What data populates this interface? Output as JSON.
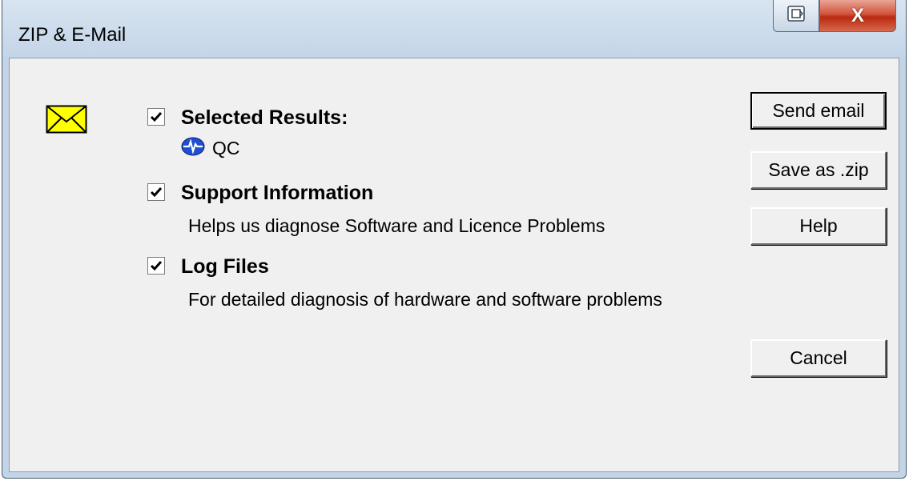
{
  "window": {
    "title": "ZIP & E-Mail",
    "close_glyph": "X"
  },
  "options": {
    "selected_results": {
      "label": "Selected Results:",
      "checked": true,
      "items": [
        {
          "label": "QC",
          "icon": "pulse-badge-icon"
        }
      ]
    },
    "support_information": {
      "label": "Support Information",
      "checked": true,
      "description": "Helps us diagnose Software and Licence Problems"
    },
    "log_files": {
      "label": "Log Files",
      "checked": true,
      "description": "For detailed diagnosis of hardware and software problems"
    }
  },
  "buttons": {
    "send_email": "Send email",
    "save_zip": "Save as .zip",
    "help": "Help",
    "cancel": "Cancel"
  },
  "colors": {
    "envelope_fill": "#ffff00",
    "close_button": "#c8452c",
    "dialog_background": "#f0f0f0",
    "result_icon": "#1f4fd1"
  },
  "icons": {
    "envelope": "envelope-icon",
    "restore": "restore-icon",
    "close": "close-icon",
    "checkmark": "checkmark-icon"
  }
}
